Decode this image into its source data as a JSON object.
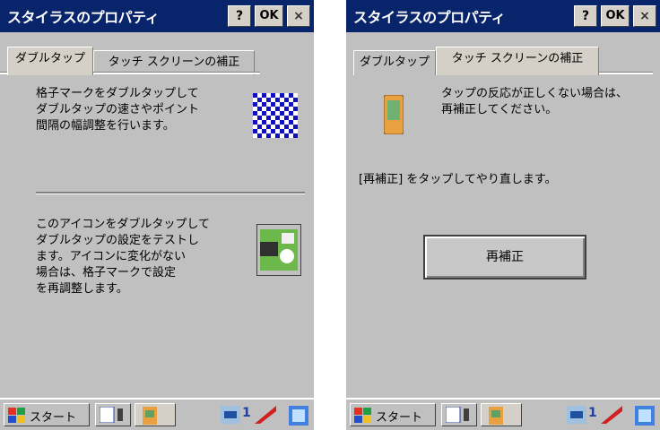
{
  "left": {
    "title": "スタイラスのプロパティ",
    "help_label": "?",
    "ok_label": "OK",
    "close_label": "×",
    "tabs": [
      {
        "label": "ダブルタップ"
      },
      {
        "label": "タッチ スクリーンの補正"
      }
    ],
    "text1": "格子マークをダブルタップして\nダブルタップの速さやポイント\n間隔の幅調整を行います。",
    "text2": "このアイコンをダブルタップして\nダブルタップの設定をテストし\nます。アイコンに変化がない\n場合は、格子マークで設定\nを再調整します。",
    "taskbar": {
      "start": "スタート",
      "num": "1"
    }
  },
  "right": {
    "title": "スタイラスのプロパティ",
    "help_label": "?",
    "ok_label": "OK",
    "close_label": "×",
    "tabs": [
      {
        "label": "ダブルタップ"
      },
      {
        "label": "タッチ スクリーンの補正"
      }
    ],
    "text1": "タップの反応が正しくない場合は、\n再補正してください。",
    "text2": "[再補正] をタップしてやり直します。",
    "button": "再補正",
    "taskbar": {
      "start": "スタート",
      "num": "1"
    }
  },
  "colors": {
    "titlebar": "#08246b",
    "background": "#c0c0c0"
  }
}
